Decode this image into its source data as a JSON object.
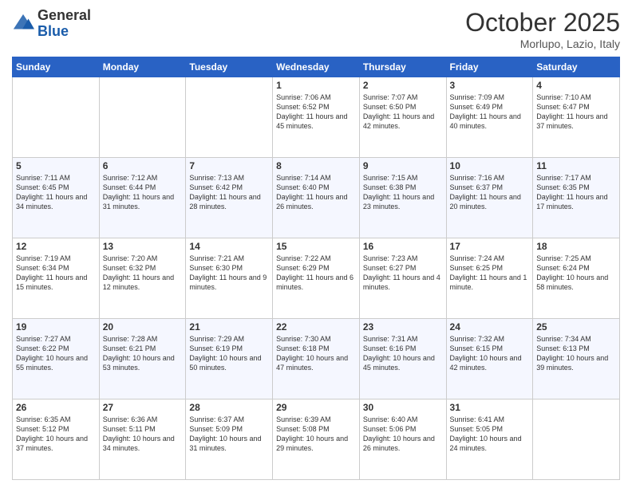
{
  "header": {
    "logo": {
      "general": "General",
      "blue": "Blue"
    },
    "title": "October 2025",
    "subtitle": "Morlupo, Lazio, Italy"
  },
  "weekdays": [
    "Sunday",
    "Monday",
    "Tuesday",
    "Wednesday",
    "Thursday",
    "Friday",
    "Saturday"
  ],
  "weeks": [
    [
      {
        "day": "",
        "info": ""
      },
      {
        "day": "",
        "info": ""
      },
      {
        "day": "",
        "info": ""
      },
      {
        "day": "1",
        "info": "Sunrise: 7:06 AM\nSunset: 6:52 PM\nDaylight: 11 hours and 45 minutes."
      },
      {
        "day": "2",
        "info": "Sunrise: 7:07 AM\nSunset: 6:50 PM\nDaylight: 11 hours and 42 minutes."
      },
      {
        "day": "3",
        "info": "Sunrise: 7:09 AM\nSunset: 6:49 PM\nDaylight: 11 hours and 40 minutes."
      },
      {
        "day": "4",
        "info": "Sunrise: 7:10 AM\nSunset: 6:47 PM\nDaylight: 11 hours and 37 minutes."
      }
    ],
    [
      {
        "day": "5",
        "info": "Sunrise: 7:11 AM\nSunset: 6:45 PM\nDaylight: 11 hours and 34 minutes."
      },
      {
        "day": "6",
        "info": "Sunrise: 7:12 AM\nSunset: 6:44 PM\nDaylight: 11 hours and 31 minutes."
      },
      {
        "day": "7",
        "info": "Sunrise: 7:13 AM\nSunset: 6:42 PM\nDaylight: 11 hours and 28 minutes."
      },
      {
        "day": "8",
        "info": "Sunrise: 7:14 AM\nSunset: 6:40 PM\nDaylight: 11 hours and 26 minutes."
      },
      {
        "day": "9",
        "info": "Sunrise: 7:15 AM\nSunset: 6:38 PM\nDaylight: 11 hours and 23 minutes."
      },
      {
        "day": "10",
        "info": "Sunrise: 7:16 AM\nSunset: 6:37 PM\nDaylight: 11 hours and 20 minutes."
      },
      {
        "day": "11",
        "info": "Sunrise: 7:17 AM\nSunset: 6:35 PM\nDaylight: 11 hours and 17 minutes."
      }
    ],
    [
      {
        "day": "12",
        "info": "Sunrise: 7:19 AM\nSunset: 6:34 PM\nDaylight: 11 hours and 15 minutes."
      },
      {
        "day": "13",
        "info": "Sunrise: 7:20 AM\nSunset: 6:32 PM\nDaylight: 11 hours and 12 minutes."
      },
      {
        "day": "14",
        "info": "Sunrise: 7:21 AM\nSunset: 6:30 PM\nDaylight: 11 hours and 9 minutes."
      },
      {
        "day": "15",
        "info": "Sunrise: 7:22 AM\nSunset: 6:29 PM\nDaylight: 11 hours and 6 minutes."
      },
      {
        "day": "16",
        "info": "Sunrise: 7:23 AM\nSunset: 6:27 PM\nDaylight: 11 hours and 4 minutes."
      },
      {
        "day": "17",
        "info": "Sunrise: 7:24 AM\nSunset: 6:25 PM\nDaylight: 11 hours and 1 minute."
      },
      {
        "day": "18",
        "info": "Sunrise: 7:25 AM\nSunset: 6:24 PM\nDaylight: 10 hours and 58 minutes."
      }
    ],
    [
      {
        "day": "19",
        "info": "Sunrise: 7:27 AM\nSunset: 6:22 PM\nDaylight: 10 hours and 55 minutes."
      },
      {
        "day": "20",
        "info": "Sunrise: 7:28 AM\nSunset: 6:21 PM\nDaylight: 10 hours and 53 minutes."
      },
      {
        "day": "21",
        "info": "Sunrise: 7:29 AM\nSunset: 6:19 PM\nDaylight: 10 hours and 50 minutes."
      },
      {
        "day": "22",
        "info": "Sunrise: 7:30 AM\nSunset: 6:18 PM\nDaylight: 10 hours and 47 minutes."
      },
      {
        "day": "23",
        "info": "Sunrise: 7:31 AM\nSunset: 6:16 PM\nDaylight: 10 hours and 45 minutes."
      },
      {
        "day": "24",
        "info": "Sunrise: 7:32 AM\nSunset: 6:15 PM\nDaylight: 10 hours and 42 minutes."
      },
      {
        "day": "25",
        "info": "Sunrise: 7:34 AM\nSunset: 6:13 PM\nDaylight: 10 hours and 39 minutes."
      }
    ],
    [
      {
        "day": "26",
        "info": "Sunrise: 6:35 AM\nSunset: 5:12 PM\nDaylight: 10 hours and 37 minutes."
      },
      {
        "day": "27",
        "info": "Sunrise: 6:36 AM\nSunset: 5:11 PM\nDaylight: 10 hours and 34 minutes."
      },
      {
        "day": "28",
        "info": "Sunrise: 6:37 AM\nSunset: 5:09 PM\nDaylight: 10 hours and 31 minutes."
      },
      {
        "day": "29",
        "info": "Sunrise: 6:39 AM\nSunset: 5:08 PM\nDaylight: 10 hours and 29 minutes."
      },
      {
        "day": "30",
        "info": "Sunrise: 6:40 AM\nSunset: 5:06 PM\nDaylight: 10 hours and 26 minutes."
      },
      {
        "day": "31",
        "info": "Sunrise: 6:41 AM\nSunset: 5:05 PM\nDaylight: 10 hours and 24 minutes."
      },
      {
        "day": "",
        "info": ""
      }
    ]
  ]
}
